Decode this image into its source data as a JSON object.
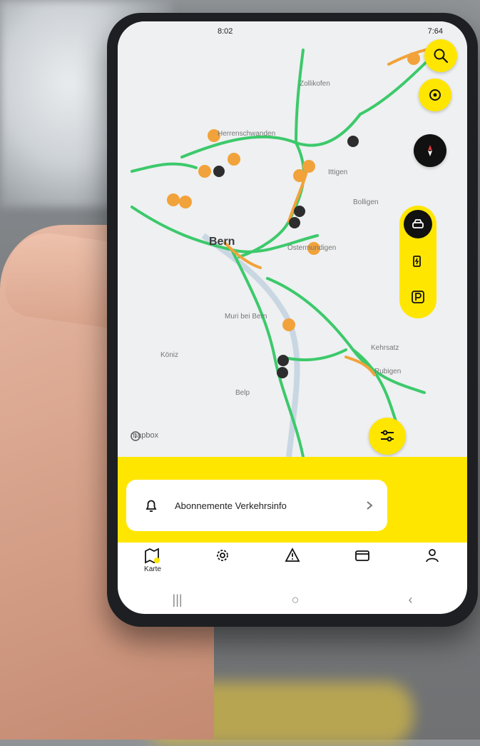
{
  "statusbar": {
    "time": "8:02",
    "right": "7:64"
  },
  "map": {
    "labels": [
      "Zollikofen",
      "Herrenschwanden",
      "Ittigen",
      "Bolligen",
      "Bern",
      "Ostermundigen",
      "Muri bei Bern",
      "Köniz",
      "Kehrsatz",
      "Rubigen",
      "Belp"
    ]
  },
  "attribution": "mapbox",
  "banner": {
    "label": "Abonnemente Verkehrsinfo"
  },
  "tabs": [
    {
      "label": "Karte",
      "icon": "map-icon"
    },
    {
      "label": "",
      "icon": "gear-icon"
    },
    {
      "label": "",
      "icon": "warning-icon"
    },
    {
      "label": "",
      "icon": "ticket-icon"
    },
    {
      "label": "",
      "icon": "user-icon"
    }
  ],
  "sysnav": {
    "recent": "|||",
    "home": "○",
    "back": "‹"
  },
  "colors": {
    "accent": "#ffe600",
    "traffic_free": "#3cc96b",
    "traffic_slow": "#f2a23a"
  }
}
